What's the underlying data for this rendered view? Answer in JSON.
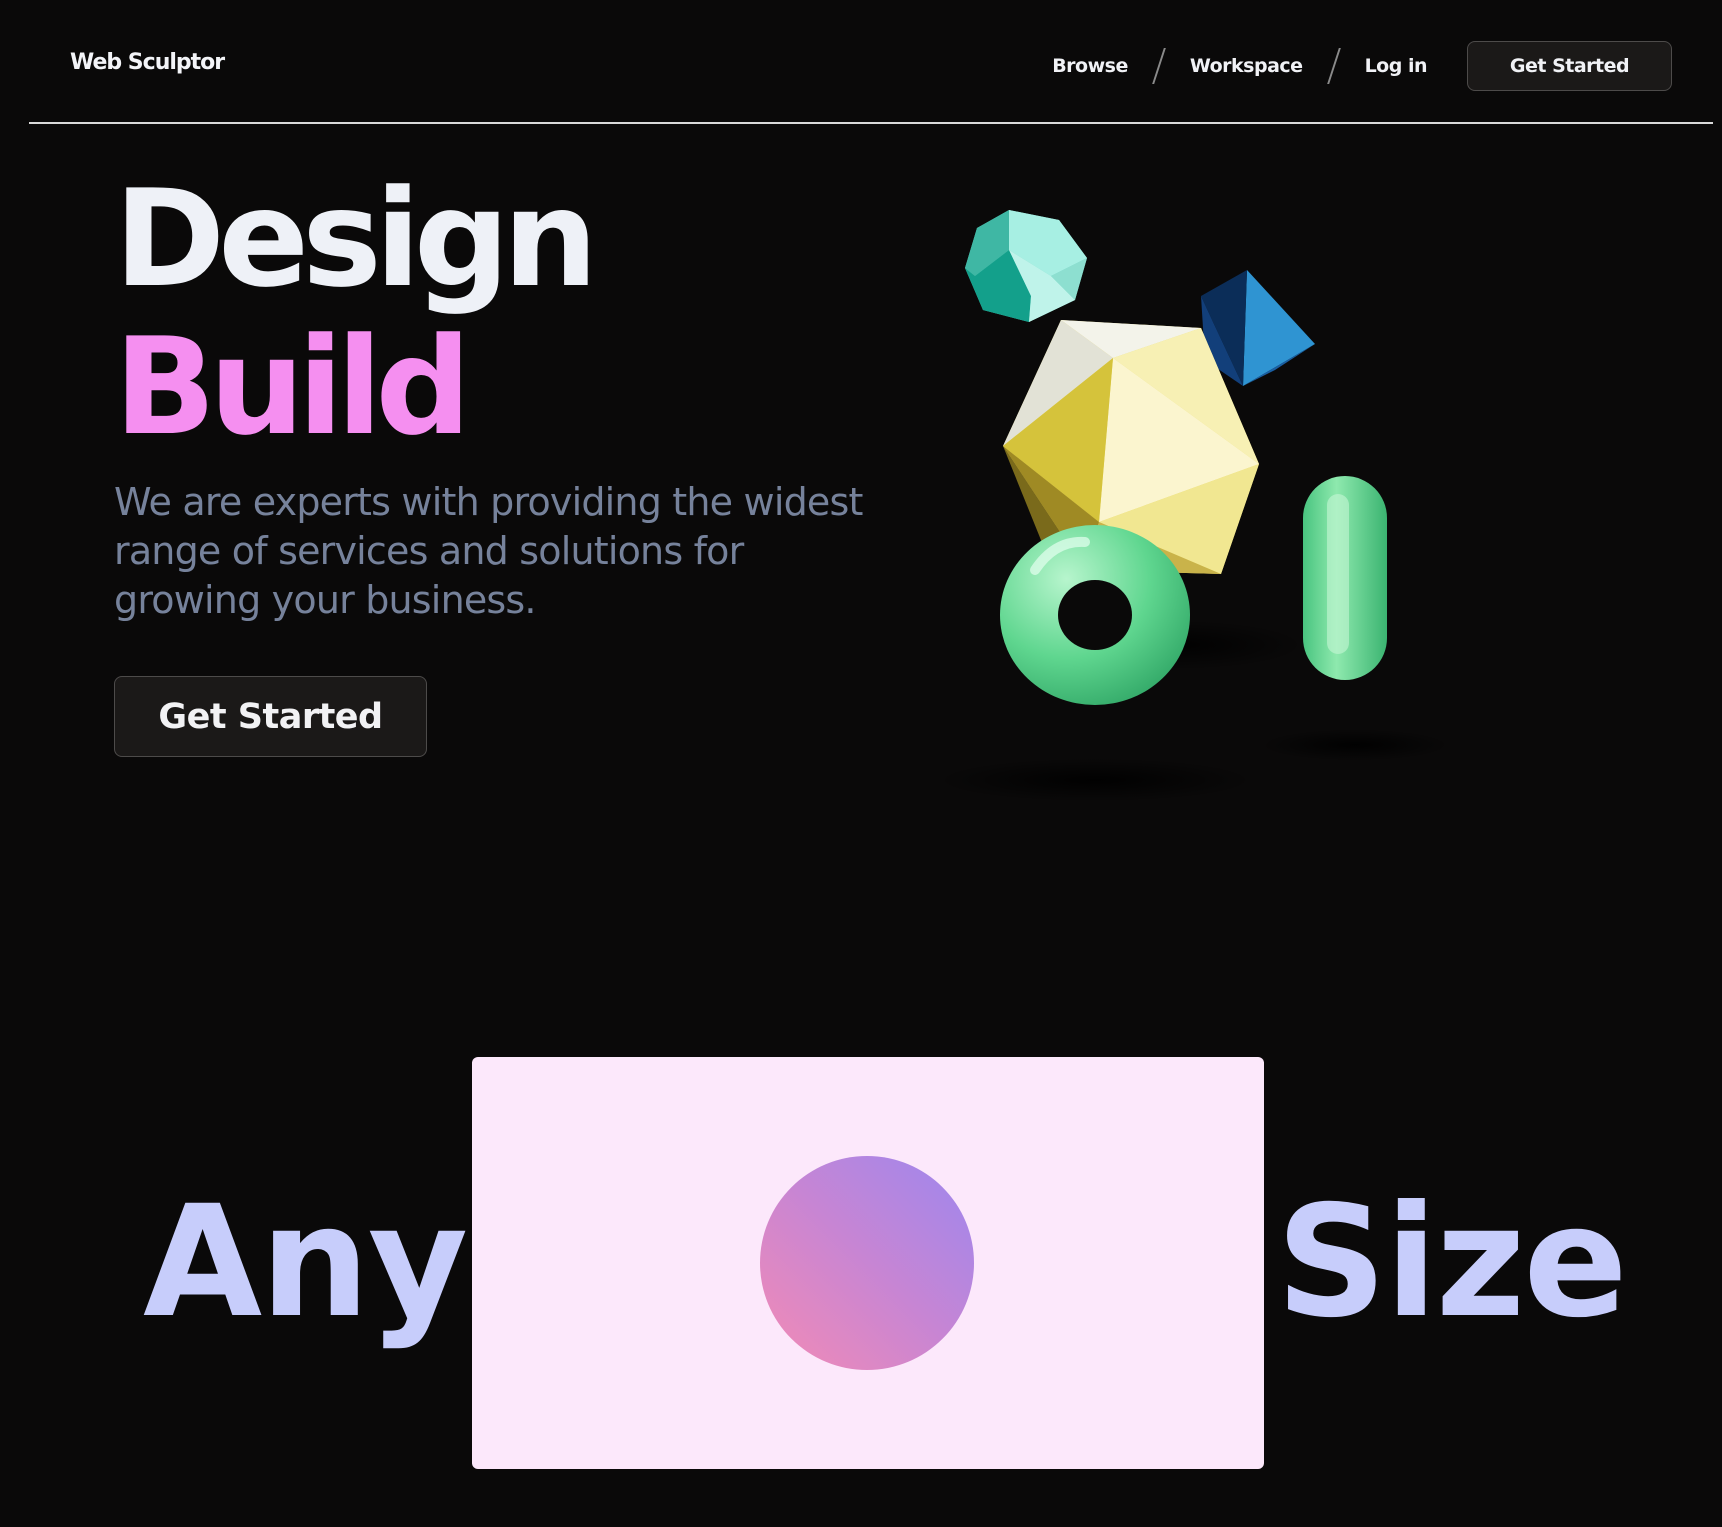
{
  "nav": {
    "logo": "Web Sculptor",
    "links": [
      "Browse",
      "Workspace",
      "Log in"
    ],
    "cta_label": "Get Started"
  },
  "hero": {
    "title_line1": "Design",
    "title_line2": "Build",
    "description": "We are experts with providing the widest range of services and solutions for growing your business.",
    "cta_label": "Get Started",
    "illustration_icon": "3d-shapes-icon"
  },
  "showcase": {
    "word_left": "Any",
    "word_right": "Size"
  },
  "colors": {
    "background": "#0a0909",
    "heading": "#eef1f7",
    "accent_pink": "#f58ff0",
    "body_text": "#76829b",
    "lavender": "#c7cdfb",
    "card_bg": "#fce8fb"
  }
}
